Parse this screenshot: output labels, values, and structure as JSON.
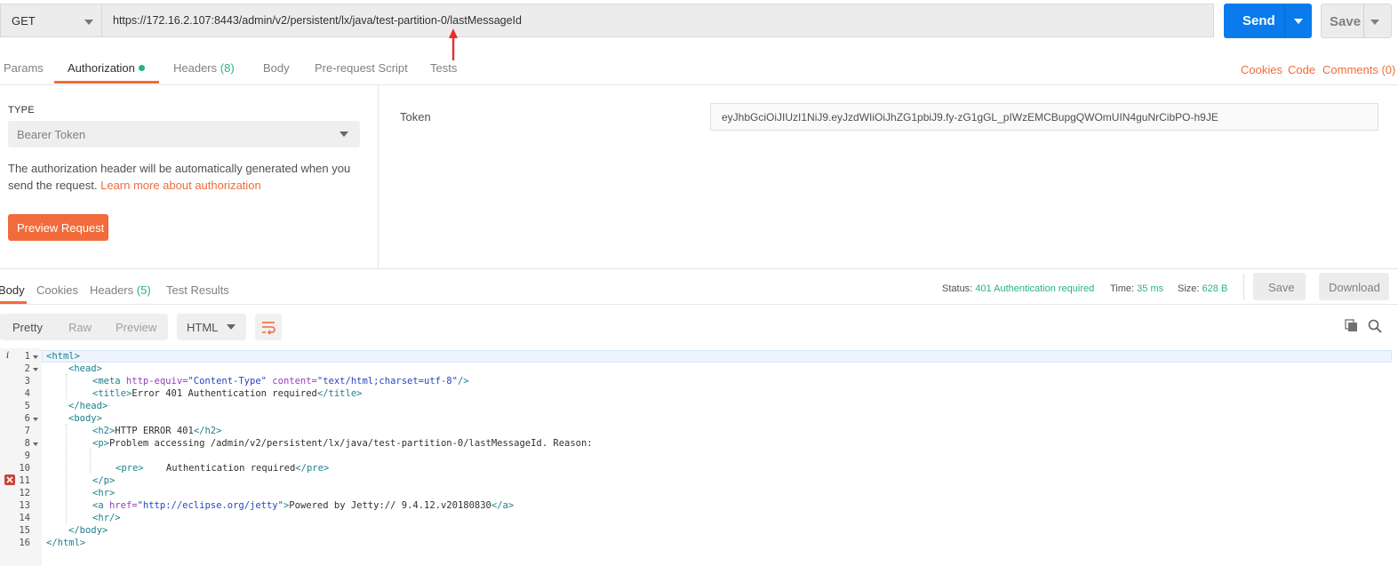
{
  "request": {
    "method": "GET",
    "url": "https://172.16.2.107:8443/admin/v2/persistent/lx/java/test-partition-0/lastMessageId",
    "send_label": "Send",
    "save_label": "Save"
  },
  "request_tabs": {
    "params": "Params",
    "authorization": "Authorization",
    "headers": "Headers",
    "headers_count": "(8)",
    "body": "Body",
    "prerequest": "Pre-request Script",
    "tests": "Tests"
  },
  "request_links": {
    "cookies": "Cookies",
    "code": "Code",
    "comments": "Comments (0)"
  },
  "auth": {
    "type_label": "TYPE",
    "type_value": "Bearer Token",
    "description": "The authorization header will be automatically generated when you send the request.",
    "learn_more": "Learn more about authorization",
    "preview_label": "Preview Request",
    "token_label": "Token",
    "token_value": "eyJhbGciOiJIUzI1NiJ9.eyJzdWIiOiJhZG1pbiJ9.fy-zG1gGL_pIWzEMCBupgQWOmUIN4guNrCibPO-h9JE"
  },
  "response_tabs": {
    "body": "Body",
    "cookies": "Cookies",
    "headers": "Headers",
    "headers_count": "(5)",
    "test_results": "Test Results"
  },
  "response_status": {
    "status_label": "Status:",
    "status_value": "401 Authentication required",
    "time_label": "Time:",
    "time_value": "35 ms",
    "size_label": "Size:",
    "size_value": "628 B",
    "save_label": "Save",
    "download_label": "Download"
  },
  "response_format": {
    "pretty": "Pretty",
    "raw": "Raw",
    "preview": "Preview",
    "language": "HTML"
  },
  "code": {
    "line_numbers": [
      "1",
      "2",
      "3",
      "4",
      "5",
      "6",
      "7",
      "8",
      "9",
      "10",
      "11",
      "12",
      "13",
      "14",
      "15",
      "16"
    ],
    "l1": "<html>",
    "l2": "<head>",
    "l3a": "<meta",
    "l3b": " http-equiv=",
    "l3c": "\"Content-Type\"",
    "l3d": " content=",
    "l3e": "\"text/html;charset=utf-8\"",
    "l3f": "/>",
    "l4a": "<title>",
    "l4b": "Error 401 Authentication required",
    "l4c": "</title>",
    "l5": "</head>",
    "l6": "<body>",
    "l7a": "<h2>",
    "l7b": "HTTP ERROR 401",
    "l7c": "</h2>",
    "l8a": "<p>",
    "l8b": "Problem accessing /admin/v2/persistent/lx/java/test-partition-0/lastMessageId. Reason:",
    "l10a": "<pre>",
    "l10b": "    Authentication required",
    "l10c": "</pre>",
    "l11": "</p>",
    "l12": "<hr>",
    "l13a": "<a",
    "l13b": " href=",
    "l13c": "\"http://eclipse.org/jetty\"",
    "l13d": ">",
    "l13e": "Powered by Jetty:// 9.4.12.v20180830",
    "l13f": "</a>",
    "l14": "<hr/>",
    "l15": "</body>",
    "l16": "</html>"
  },
  "colors": {
    "accent": "#f26b3a",
    "send": "#097bed",
    "success": "#26b47f"
  }
}
